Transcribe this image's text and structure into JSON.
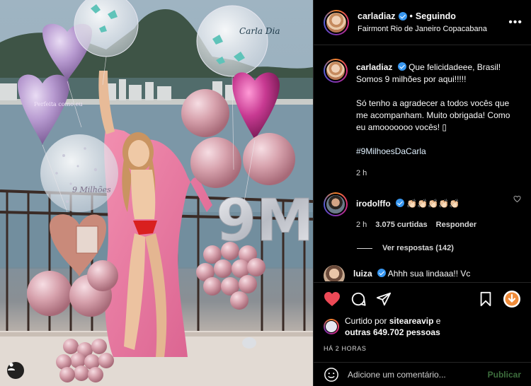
{
  "post": {
    "username": "carladiaz",
    "follow_status": "Seguindo",
    "location": "Fairmont Rio de Janeiro Copacabana",
    "more_label": "•••"
  },
  "caption": {
    "username": "carladiaz",
    "line1": "Que felicidadeee, Brasil! Somos 9 milhões por aqui!!!!!",
    "line2": "Só tenho a agradecer a todos vocês que me acompanham. Muito obrigada! Como eu amooooooo vocês! ▯",
    "hashtag": "#9MilhoesDaCarla",
    "age": "2 h"
  },
  "comments": [
    {
      "username": "irodolffo",
      "text": "👏🏻👏🏻👏🏻👏🏻👏🏻",
      "age": "2 h",
      "likes": "3.075 curtidas",
      "reply_label": "Responder",
      "view_replies": "Ver respostas (142)"
    },
    {
      "username": "luiza",
      "text": "Ahhh sua lindaaa!! Vc"
    }
  ],
  "likes": {
    "prefix": "Curtido por",
    "liker": "siteareavip",
    "conj": "e",
    "others": "outras 649.702 pessoas"
  },
  "timestamp": "HÁ 2 HORAS",
  "add_comment": {
    "placeholder": "Adicione um comentário...",
    "post_label": "Publicar"
  },
  "photo": {
    "balloon_text_top_right": "Carla Dia",
    "balloon_text_left": "Perfeita como eu",
    "balloon_text_clear": "9 Milhões",
    "number_balloon": "9M"
  },
  "icons": {
    "like": "heart-filled-icon",
    "comment": "comment-icon",
    "share": "paper-plane-icon",
    "save": "bookmark-icon",
    "emoji": "smiley-icon",
    "user_tag": "person-icon"
  },
  "colors": {
    "like_red": "#ed4956",
    "link_blue": "#e0f1ff",
    "verified_blue": "#3897f0",
    "post_button": "#3d6e3d"
  }
}
